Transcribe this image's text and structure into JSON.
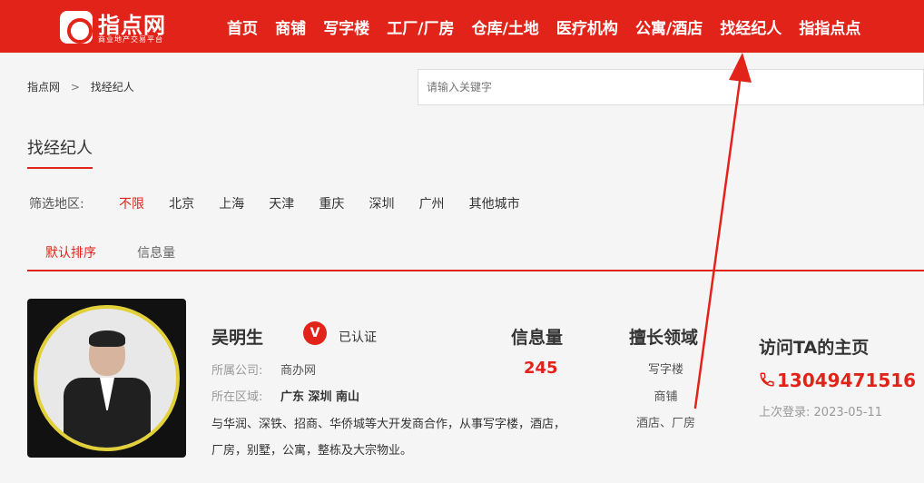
{
  "brand": {
    "title": "指点网",
    "subtitle": "商业地产交易平台",
    "accent": "#e2231a"
  },
  "nav": [
    "首页",
    "商铺",
    "写字楼",
    "工厂/厂房",
    "仓库/土地",
    "医疗机构",
    "公寓/酒店",
    "找经纪人",
    "指指点点"
  ],
  "breadcrumb": {
    "home": "指点网",
    "separator": ">",
    "current": "找经纪人"
  },
  "search": {
    "placeholder": "请输入关键字",
    "value": ""
  },
  "section_title": "找经纪人",
  "filter": {
    "label": "筛选地区:",
    "options": [
      "不限",
      "北京",
      "上海",
      "天津",
      "重庆",
      "深圳",
      "广州",
      "其他城市"
    ],
    "selected": "不限"
  },
  "sort": {
    "options": [
      "默认排序",
      "信息量"
    ],
    "selected": "默认排序"
  },
  "agent": {
    "name": "吴明生",
    "verified_text": "已认证",
    "verify_icon": "V",
    "company_label": "所属公司:",
    "company": "商办网",
    "area_label": "所在区域:",
    "area": "广东 深圳 南山",
    "description": "与华润、深铁、招商、华侨城等大开发商合作，从事写字楼，酒店，厂房，别墅，公寓，整栋及大宗物业。",
    "info_title": "信息量",
    "info_count": "245",
    "domain_title": "擅长领域",
    "domains": [
      "写字楼",
      "商铺",
      "酒店、厂房"
    ],
    "homepage_link": "访问TA的主页",
    "phone": "13049471516",
    "last_login_label": "上次登录:",
    "last_login": "2023-05-11"
  },
  "annotation_color": "#e2231a"
}
